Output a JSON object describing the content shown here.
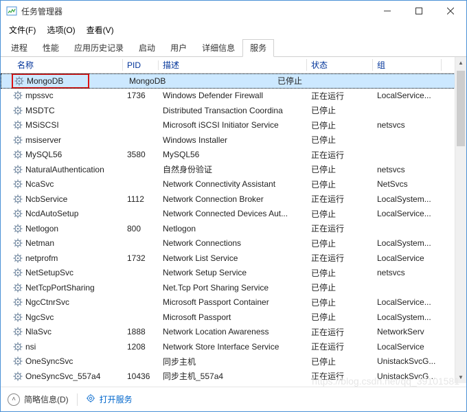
{
  "window": {
    "title": "任务管理器"
  },
  "menu": {
    "file": "文件(F)",
    "options": "选项(O)",
    "view": "查看(V)"
  },
  "tabs": {
    "processes": "进程",
    "performance": "性能",
    "history": "应用历史记录",
    "startup": "启动",
    "users": "用户",
    "details": "详细信息",
    "services": "服务"
  },
  "columns": {
    "name": "名称",
    "pid": "PID",
    "desc": "描述",
    "status": "状态",
    "group": "组"
  },
  "status_running": "正在运行",
  "status_stopped": "已停止",
  "rows": [
    {
      "name": "MongoDB",
      "pid": "",
      "desc": "MongoDB",
      "status": "已停止",
      "group": "",
      "selected": true
    },
    {
      "name": "mpssvc",
      "pid": "1736",
      "desc": "Windows Defender Firewall",
      "status": "正在运行",
      "group": "LocalService..."
    },
    {
      "name": "MSDTC",
      "pid": "",
      "desc": "Distributed Transaction Coordina",
      "status": "已停止",
      "group": ""
    },
    {
      "name": "MSiSCSI",
      "pid": "",
      "desc": "Microsoft iSCSI Initiator Service",
      "status": "已停止",
      "group": "netsvcs"
    },
    {
      "name": "msiserver",
      "pid": "",
      "desc": "Windows Installer",
      "status": "已停止",
      "group": ""
    },
    {
      "name": "MySQL56",
      "pid": "3580",
      "desc": "MySQL56",
      "status": "正在运行",
      "group": ""
    },
    {
      "name": "NaturalAuthentication",
      "pid": "",
      "desc": "自然身份验证",
      "status": "已停止",
      "group": "netsvcs"
    },
    {
      "name": "NcaSvc",
      "pid": "",
      "desc": "Network Connectivity Assistant",
      "status": "已停止",
      "group": "NetSvcs"
    },
    {
      "name": "NcbService",
      "pid": "1112",
      "desc": "Network Connection Broker",
      "status": "正在运行",
      "group": "LocalSystem..."
    },
    {
      "name": "NcdAutoSetup",
      "pid": "",
      "desc": "Network Connected Devices Aut...",
      "status": "已停止",
      "group": "LocalService..."
    },
    {
      "name": "Netlogon",
      "pid": "800",
      "desc": "Netlogon",
      "status": "正在运行",
      "group": ""
    },
    {
      "name": "Netman",
      "pid": "",
      "desc": "Network Connections",
      "status": "已停止",
      "group": "LocalSystem..."
    },
    {
      "name": "netprofm",
      "pid": "1732",
      "desc": "Network List Service",
      "status": "正在运行",
      "group": "LocalService"
    },
    {
      "name": "NetSetupSvc",
      "pid": "",
      "desc": "Network Setup Service",
      "status": "已停止",
      "group": "netsvcs"
    },
    {
      "name": "NetTcpPortSharing",
      "pid": "",
      "desc": "Net.Tcp Port Sharing Service",
      "status": "已停止",
      "group": ""
    },
    {
      "name": "NgcCtnrSvc",
      "pid": "",
      "desc": "Microsoft Passport Container",
      "status": "已停止",
      "group": "LocalService..."
    },
    {
      "name": "NgcSvc",
      "pid": "",
      "desc": "Microsoft Passport",
      "status": "已停止",
      "group": "LocalSystem..."
    },
    {
      "name": "NlaSvc",
      "pid": "1888",
      "desc": "Network Location Awareness",
      "status": "正在运行",
      "group": "NetworkServ"
    },
    {
      "name": "nsi",
      "pid": "1208",
      "desc": "Network Store Interface Service",
      "status": "正在运行",
      "group": "LocalService"
    },
    {
      "name": "OneSyncSvc",
      "pid": "",
      "desc": "同步主机",
      "status": "已停止",
      "group": "UnistackSvcG..."
    },
    {
      "name": "OneSyncSvc_557a4",
      "pid": "10436",
      "desc": "同步主机_557a4",
      "status": "正在运行",
      "group": "UnistackSvcG..."
    }
  ],
  "footer": {
    "collapse": "简略信息(D)",
    "open_services": "打开服务"
  },
  "watermark": "https://blog.csdn.net/qq_39101581"
}
